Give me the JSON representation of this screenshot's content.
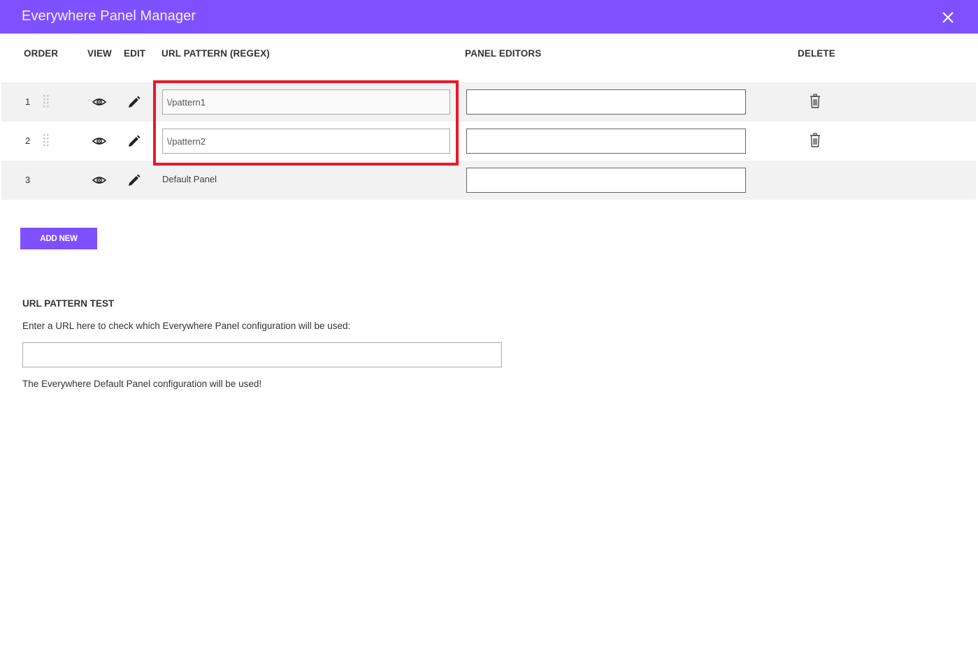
{
  "window": {
    "title": "Everywhere Panel Manager",
    "close_icon": "close-icon"
  },
  "columns": {
    "order": "ORDER",
    "view": "VIEW",
    "edit": "EDIT",
    "url_pattern": "URL PATTERN (REGEX)",
    "panel_editors": "PANEL EDITORS",
    "delete": "DELETE"
  },
  "rows": [
    {
      "order": "1",
      "pattern": "\\/pattern1",
      "editable_pattern": true,
      "panel_editors": "",
      "deletable": true,
      "draggable": true
    },
    {
      "order": "2",
      "pattern": "\\/pattern2",
      "editable_pattern": true,
      "panel_editors": "",
      "deletable": true,
      "draggable": true
    },
    {
      "order": "3",
      "pattern": "Default Panel",
      "editable_pattern": false,
      "panel_editors": "",
      "deletable": false,
      "draggable": false
    }
  ],
  "add_new_label": "ADD NEW",
  "url_test": {
    "title": "URL PATTERN TEST",
    "description": "Enter a URL here to check which Everywhere Panel configuration will be used:",
    "input_value": "",
    "result": "The Everywhere Default Panel configuration will be used!"
  },
  "colors": {
    "brand": "#7f50ff",
    "highlight": "#e8192a",
    "row_shade": "#f2f2f2"
  }
}
